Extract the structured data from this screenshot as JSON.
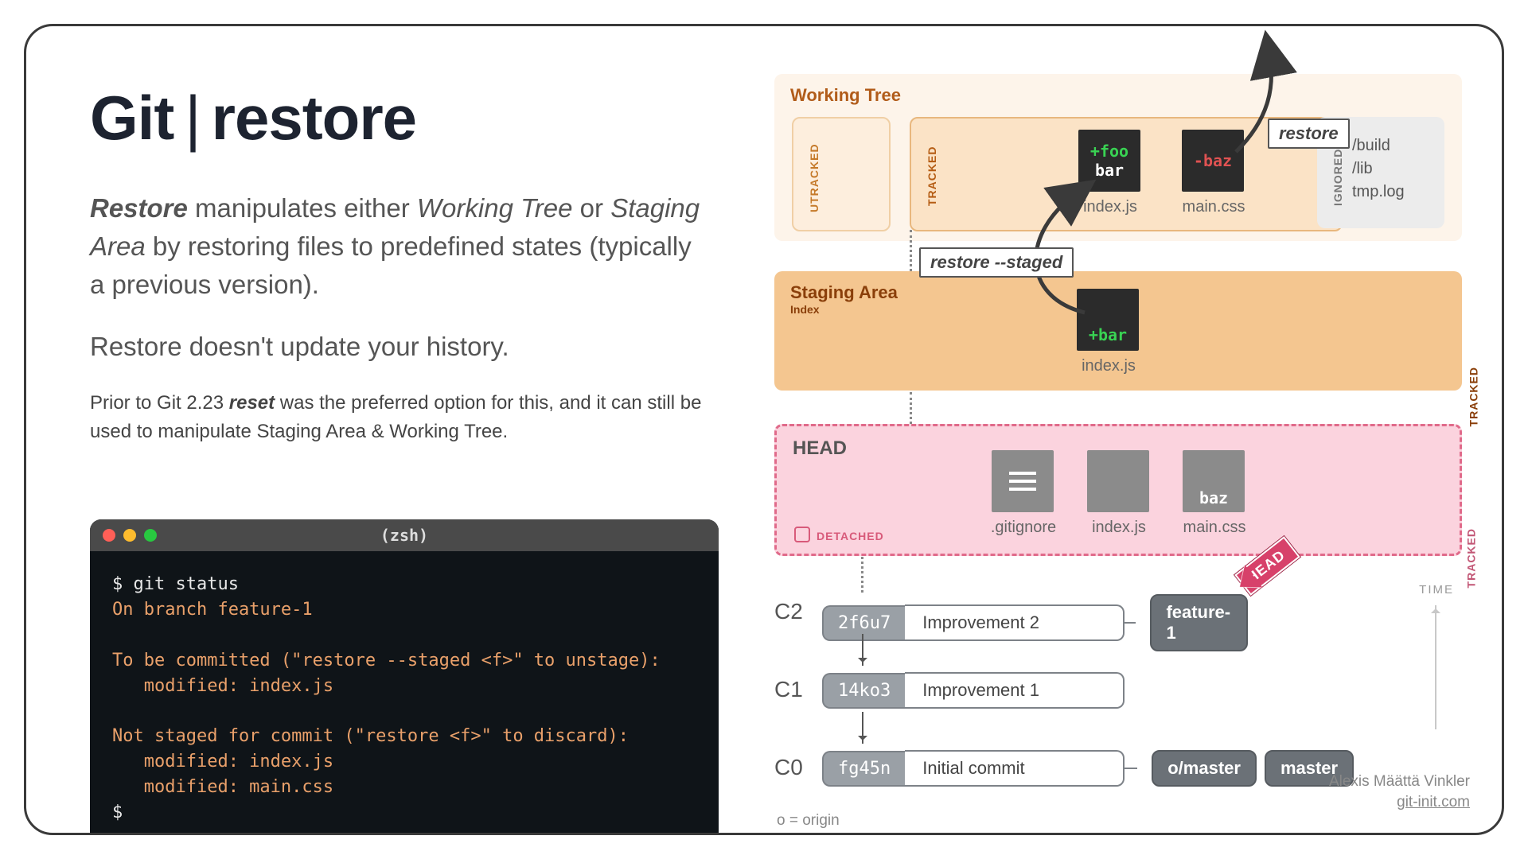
{
  "title": {
    "left": "Git",
    "right": "restore"
  },
  "lead1_b": "Restore",
  "lead1": " manipulates either ",
  "lead1_i1": "Working Tree",
  "lead1_mid": " or ",
  "lead1_i2": "Staging Area",
  "lead1_end": " by restoring files to predefined states (typically a previous version).",
  "lead2": "Restore doesn't update your history.",
  "note_pre": "Prior to Git 2.23 ",
  "note_b": "reset",
  "note_post": " was the preferred option for this, and it can still be used to manipulate Staging Area & Working Tree.",
  "terminal": {
    "title": "(zsh)",
    "l1": "$ git status",
    "l2": "On branch feature-1",
    "l3": "To be committed (\"restore --staged <f>\" to unstage):",
    "l4": "   modified: index.js",
    "l5": "Not staged for commit (\"restore <f>\" to discard):",
    "l6": "   modified: index.js",
    "l7": "   modified: main.css",
    "l8": "$"
  },
  "areas": {
    "working": "Working Tree",
    "utracked": "UTRACKED",
    "tracked": "TRACKED",
    "ignored": "IGNORED",
    "ignored_files": "/build\n/lib\ntmp.log",
    "staging": "Staging Area",
    "staging_sub": "Index",
    "head": "HEAD",
    "detached": "DETACHED"
  },
  "files": {
    "wt_index_l1": "+foo",
    "wt_index_l2": "bar",
    "wt_index_label": "index.js",
    "wt_main_l1": "-baz",
    "wt_main_label": "main.css",
    "st_index_l1": "+bar",
    "st_index_label": "index.js",
    "h1": ".gitignore",
    "h2": "index.js",
    "h3": "main.css",
    "h3_txt": "baz"
  },
  "annot": {
    "restore": "restore",
    "restore_staged": "restore --staged"
  },
  "commits": [
    {
      "id": "C2",
      "hash": "2f6u7",
      "msg": "Improvement 2",
      "branches": [
        "feature-1"
      ]
    },
    {
      "id": "C1",
      "hash": "14ko3",
      "msg": "Improvement 1",
      "branches": []
    },
    {
      "id": "C0",
      "hash": "fg45n",
      "msg": "Initial commit",
      "branches": [
        "o/master",
        "master"
      ]
    }
  ],
  "head_flag": "HEAD",
  "time": "TIME",
  "olegend": "o = origin",
  "credit": {
    "name": "Alexis Määttä Vinkler",
    "site": "git-init.com"
  }
}
